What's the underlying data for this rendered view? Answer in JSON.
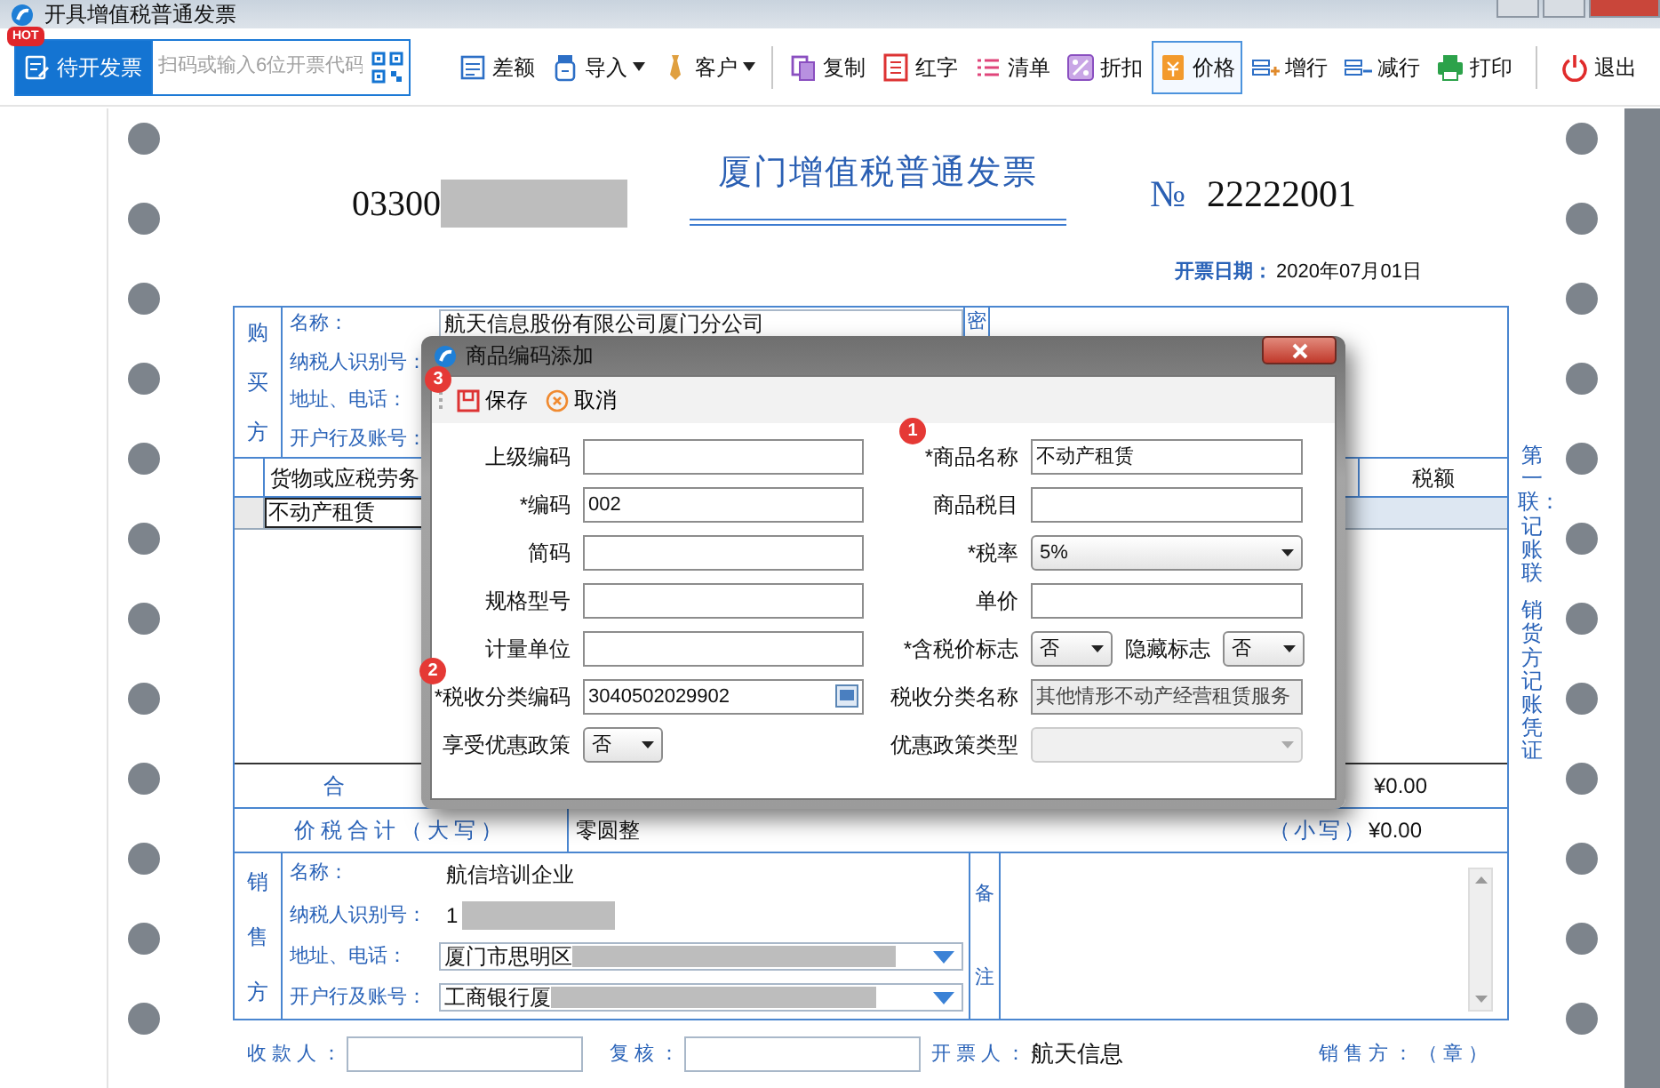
{
  "window": {
    "title": "开具增值税普通发票"
  },
  "toolbar": {
    "pending": {
      "label": "待开发票",
      "badge": "HOT"
    },
    "search": {
      "placeholder": "扫码或输入6位开票代码"
    },
    "buttons": [
      {
        "label": "差额",
        "dropdown": false,
        "selected": false
      },
      {
        "label": "导入",
        "dropdown": true,
        "selected": false
      },
      {
        "label": "客户",
        "dropdown": true,
        "selected": false
      },
      {
        "label": "复制",
        "dropdown": false,
        "selected": false
      },
      {
        "label": "红字",
        "dropdown": false,
        "selected": false
      },
      {
        "label": "清单",
        "dropdown": false,
        "selected": false
      },
      {
        "label": "折扣",
        "dropdown": false,
        "selected": false
      },
      {
        "label": "价格",
        "dropdown": false,
        "selected": true
      },
      {
        "label": "增行",
        "dropdown": false,
        "selected": false
      },
      {
        "label": "减行",
        "dropdown": false,
        "selected": false
      },
      {
        "label": "打印",
        "dropdown": false,
        "selected": false
      },
      {
        "label": "退出",
        "dropdown": false,
        "selected": false
      }
    ]
  },
  "invoice": {
    "code": "03300",
    "title": "厦门增值税普通发票",
    "number_sign": "№",
    "number": "22222001",
    "date_label": "开票日期：",
    "date": "2020年07月01日",
    "buyer": {
      "side_label": "购买方",
      "cipher_label": "密",
      "rows": [
        {
          "label": "名称：",
          "value": "航天信息股份有限公司厦门分公司"
        },
        {
          "label": "纳税人识别号："
        },
        {
          "label": "地址、电话："
        },
        {
          "label": "开户行及账号："
        }
      ]
    },
    "items": {
      "columns": [
        "货物或应税劳务",
        "税额"
      ],
      "rows": [
        {
          "name": "不动产租赁",
          "selected": true
        }
      ],
      "total_label": "合",
      "total_tax": "¥0.00"
    },
    "grand_total": {
      "label": "价税合计（大写）",
      "words": "零圆整",
      "small_label": "（小写）",
      "amount": "¥0.00"
    },
    "seller": {
      "side_label": "销售方",
      "remark_labels": [
        "备",
        "注"
      ],
      "rows": [
        {
          "label": "名称：",
          "value": "航信培训企业",
          "kind": "text"
        },
        {
          "label": "纳税人识别号：",
          "value": "1",
          "kind": "text"
        },
        {
          "label": "地址、电话：",
          "value": "厦门市思明区",
          "kind": "combo"
        },
        {
          "label": "开户行及账号：",
          "value": "工商银行厦",
          "kind": "combo"
        }
      ]
    },
    "footer": [
      {
        "label": "收款人：",
        "kind": "field"
      },
      {
        "label": "复核：",
        "kind": "field"
      },
      {
        "label": "开票人：",
        "value": "航天信息",
        "kind": "text"
      },
      {
        "label": "销售方：（章）",
        "kind": "text"
      }
    ],
    "copy_note": [
      "第一联：记账联",
      "销货方记账凭证"
    ]
  },
  "dialog": {
    "title": "商品编码添加",
    "actions": [
      {
        "label": "保存",
        "badge": "3"
      },
      {
        "label": "取消"
      }
    ],
    "rows": [
      {
        "cells": [
          {
            "label": "上级编码",
            "kind": "text",
            "disabled": false
          },
          {
            "label": "*商品名称",
            "kind": "text",
            "value": "不动产租赁",
            "badge": "1",
            "disabled": false
          }
        ]
      },
      {
        "cells": [
          {
            "label": "*编码",
            "kind": "text",
            "value": "002",
            "disabled": false
          },
          {
            "label": "商品税目",
            "kind": "text",
            "disabled": false
          }
        ]
      },
      {
        "cells": [
          {
            "label": "简码",
            "kind": "text",
            "disabled": false
          },
          {
            "label": "*税率",
            "kind": "select",
            "value": "5%",
            "disabled": false
          }
        ]
      },
      {
        "cells": [
          {
            "label": "规格型号",
            "kind": "text",
            "disabled": false
          },
          {
            "label": "单价",
            "kind": "text",
            "disabled": false
          }
        ]
      },
      {
        "cells": [
          {
            "label": "计量单位",
            "kind": "text",
            "disabled": false
          },
          {
            "label": "*含税价标志",
            "kind": "select",
            "value": "否",
            "disabled": false
          },
          {
            "label": "隐藏标志",
            "kind": "select",
            "value": "否",
            "disabled": false
          }
        ]
      },
      {
        "cells": [
          {
            "label": "*税收分类编码",
            "kind": "picker",
            "value": "3040502029902",
            "badge": "2",
            "disabled": false
          },
          {
            "label": "税收分类名称",
            "kind": "text",
            "value": "其他情形不动产经营租赁服务",
            "disabled": true
          }
        ]
      },
      {
        "cells": [
          {
            "label": "享受优惠政策",
            "kind": "select",
            "value": "否",
            "disabled": false
          },
          {
            "label": "优惠政策类型",
            "kind": "select",
            "disabled": true
          }
        ]
      }
    ]
  }
}
